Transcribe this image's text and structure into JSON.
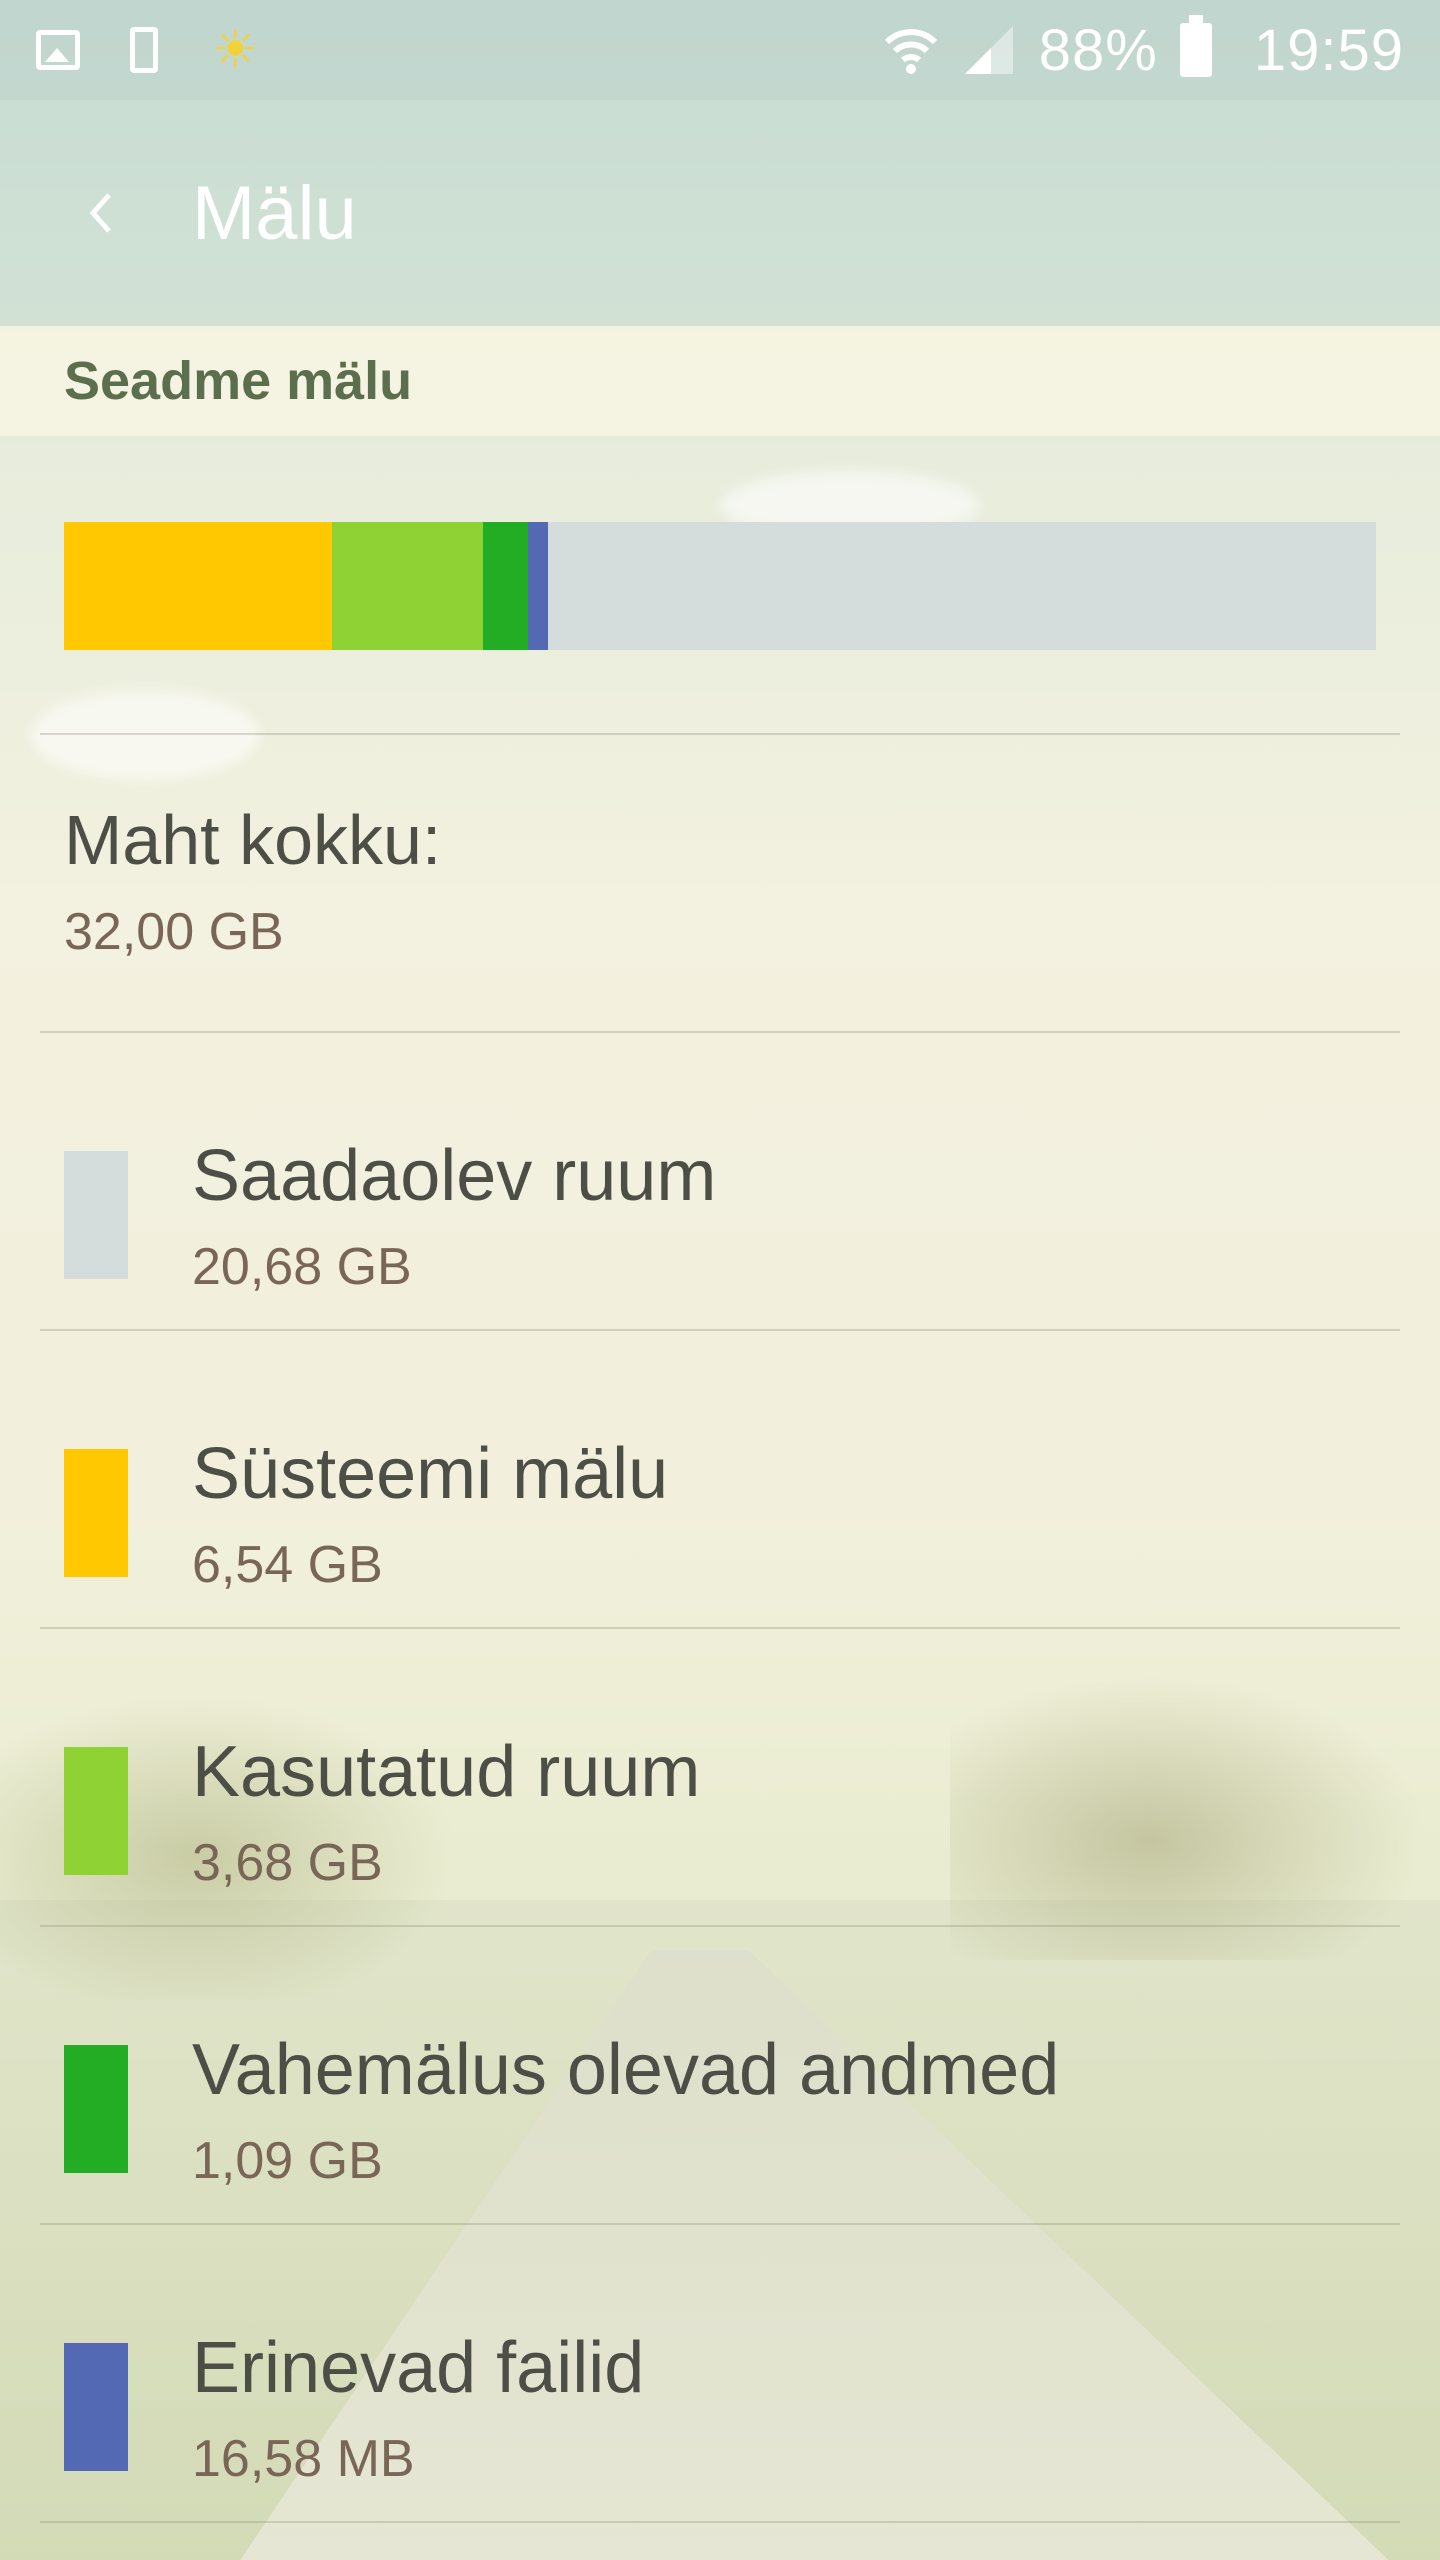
{
  "status_bar": {
    "icons_left": [
      "image-icon",
      "phone-icon",
      "sun-icon"
    ],
    "battery": "88%",
    "time": "19:59"
  },
  "app_bar": {
    "back_icon": "chevron-left-icon",
    "title": "Mälu"
  },
  "section": {
    "title": "Seadme mälu"
  },
  "usage_bar": {
    "segments": [
      {
        "name": "Süsteemi mälu",
        "value_gb": 6.54,
        "color": "#ffc800"
      },
      {
        "name": "Kasutatud ruum",
        "value_gb": 3.68,
        "color": "#8fd234"
      },
      {
        "name": "Vahemälus olevad andmed",
        "value_gb": 1.09,
        "color": "#22ad24"
      },
      {
        "name": "Erinevad failid",
        "value_gb": 0.01658,
        "color": "#5469b3"
      },
      {
        "name": "Saadaolev ruum",
        "value_gb": 20.68,
        "color": "#d4dcdc"
      }
    ],
    "total_gb": 32.0
  },
  "total": {
    "label": "Maht kokku:",
    "value": "32,00 GB"
  },
  "items": [
    {
      "label": "Saadaolev ruum",
      "value": "20,68 GB",
      "color": "#d4dcdc"
    },
    {
      "label": "Süsteemi mälu",
      "value": "6,54 GB",
      "color": "#ffc800"
    },
    {
      "label": "Kasutatud ruum",
      "value": "3,68 GB",
      "color": "#8fd234"
    },
    {
      "label": "Vahemälus olevad andmed",
      "value": "1,09 GB",
      "color": "#22ad24"
    },
    {
      "label": "Erinevad failid",
      "value": "16,58 MB",
      "color": "#5469b3"
    }
  ]
}
